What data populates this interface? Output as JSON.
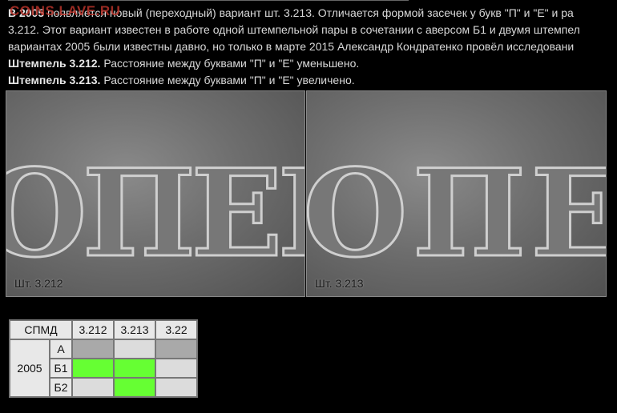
{
  "watermark": "COINS.LAVE.RU",
  "intro": {
    "year_bold": "В 2005",
    "line1": " появляется новый (переходный) вариант шт. 3.213.  Отличается формой засечек у букв \"П\" и \"Е\" и ра",
    "line2": "3.212. Этот вариант известен в работе одной штемпельной пары в сочетании с аверсом Б1 и двумя штемпел",
    "line3": "вариантах 2005 были известны давно, но только в марте 2015 Александр Кондратенко провёл исследовани"
  },
  "stamps": [
    {
      "title": "Штемпель 3.212.",
      "desc": " Расстояние между буквами \"П\" и \"Е\" уменьшено."
    },
    {
      "title": "Штемпель 3.213.",
      "desc": " Расстояние между буквами \"П\" и \"Е\" увеличено."
    }
  ],
  "photos": {
    "left_label": "Шт. 3.212",
    "right_label": "Шт. 3.213",
    "letters": "ОПЕЙ"
  },
  "table": {
    "header": "СПМД",
    "columns": [
      "3.212",
      "3.213",
      "3.22"
    ],
    "year": "2005",
    "rows": [
      {
        "label": "А",
        "cells": [
          "gray",
          "light",
          "gray"
        ]
      },
      {
        "label": "Б1",
        "cells": [
          "green",
          "green",
          "light"
        ]
      },
      {
        "label": "Б2",
        "cells": [
          "light",
          "green",
          "light"
        ]
      }
    ],
    "colors": {
      "gray": "#a9a9a9",
      "green": "#66ff33",
      "light": "#dcdcdc"
    }
  }
}
